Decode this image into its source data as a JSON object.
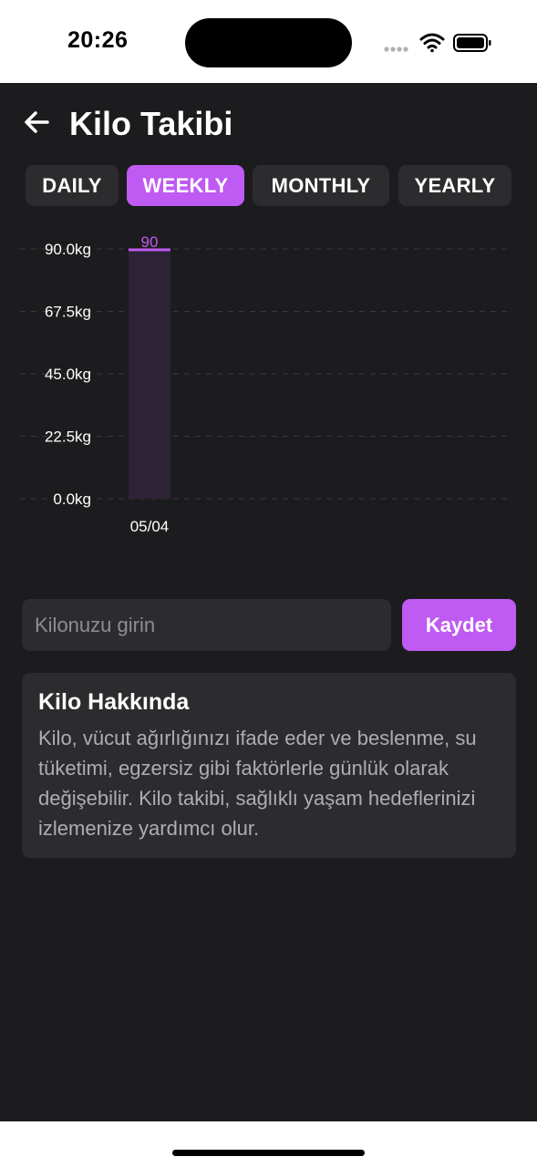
{
  "status_bar": {
    "time": "20:26",
    "icons": [
      "signal-dots-icon",
      "wifi-icon",
      "battery-icon"
    ]
  },
  "header": {
    "back_icon": "arrow-left-icon",
    "title": "Kilo Takibi"
  },
  "tabs": [
    {
      "label": "DAILY",
      "active": false
    },
    {
      "label": "WEEKLY",
      "active": true
    },
    {
      "label": "MONTHLY",
      "active": false
    },
    {
      "label": "YEARLY",
      "active": false
    }
  ],
  "colors": {
    "background": "#1c1c1e",
    "surface": "#2c2c2e",
    "accent": "#bf5af2",
    "bar_fill": "#2d2236",
    "text_primary": "#ffffff",
    "text_secondary": "#aeaeb2"
  },
  "chart_data": {
    "type": "bar",
    "categories": [
      "05/04"
    ],
    "values": [
      90
    ],
    "data_labels": [
      "90"
    ],
    "y_ticks": [
      "90.0kg",
      "67.5kg",
      "45.0kg",
      "22.5kg",
      "0.0kg"
    ],
    "ylim": [
      0,
      90
    ],
    "grid": true,
    "grid_style": "dashed",
    "legend": false
  },
  "input": {
    "placeholder": "Kilonuzu girin",
    "value": ""
  },
  "save_button": {
    "label": "Kaydet"
  },
  "info_card": {
    "title": "Kilo Hakkında",
    "text": "Kilo, vücut ağırlığınızı ifade eder ve beslenme, su tüketimi, egzersiz gibi faktörlerle günlük olarak değişebilir. Kilo takibi, sağlıklı yaşam hedeflerinizi izlemenize yardımcı olur."
  }
}
